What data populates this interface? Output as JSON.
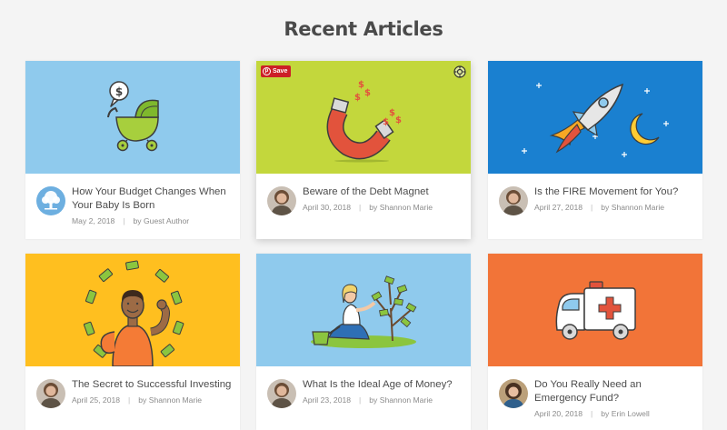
{
  "section": {
    "title": "Recent Articles"
  },
  "pin_button": {
    "label": "Save"
  },
  "articles": [
    {
      "title": "How Your Budget Changes When Your Baby Is Born",
      "date": "May 2, 2018",
      "author": "by Guest Author",
      "bg_color": "#8fcaed",
      "illustration": "stroller-icon",
      "avatar": "tree-logo-avatar"
    },
    {
      "title": "Beware of the Debt Magnet",
      "date": "April 30, 2018",
      "author": "by Shannon Marie",
      "bg_color": "#c3d73c",
      "illustration": "magnet-icon",
      "avatar": "author-avatar"
    },
    {
      "title": "Is the FIRE Movement for You?",
      "date": "April 27, 2018",
      "author": "by Shannon Marie",
      "bg_color": "#1a80d0",
      "illustration": "rocket-icon",
      "avatar": "author-avatar"
    },
    {
      "title": "The Secret to Successful Investing",
      "date": "April 25, 2018",
      "author": "by Shannon Marie",
      "bg_color": "#ffbf1f",
      "illustration": "strong-man-icon",
      "avatar": "author-avatar"
    },
    {
      "title": "What Is the Ideal Age of Money?",
      "date": "April 23, 2018",
      "author": "by Shannon Marie",
      "bg_color": "#8fcaed",
      "illustration": "money-tree-icon",
      "avatar": "author-avatar"
    },
    {
      "title": "Do You Really Need an Emergency Fund?",
      "date": "April 20, 2018",
      "author": "by Erin Lowell",
      "bg_color": "#f27438",
      "illustration": "ambulance-icon",
      "avatar": "author-avatar"
    }
  ]
}
